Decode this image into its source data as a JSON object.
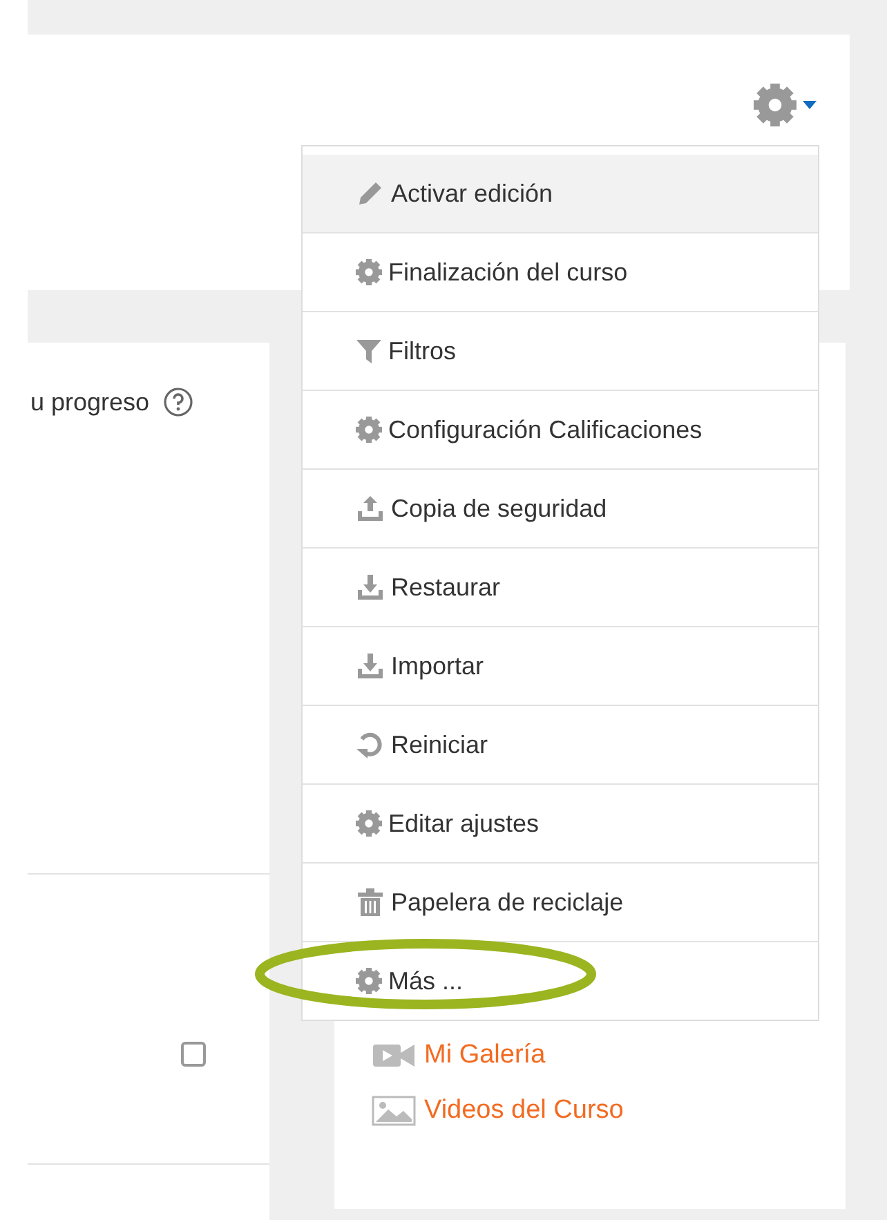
{
  "header": {
    "settings_button": {
      "expanded": true
    }
  },
  "menu": {
    "items": [
      {
        "label": "Activar edición",
        "kind": "pencil",
        "highlighted": true,
        "circled": false
      },
      {
        "label": "Finalización del curso",
        "kind": "gear",
        "highlighted": false,
        "circled": false
      },
      {
        "label": "Filtros",
        "kind": "filter",
        "highlighted": false,
        "circled": false
      },
      {
        "label": "Configuración Calificaciones",
        "kind": "gear",
        "highlighted": false,
        "circled": false
      },
      {
        "label": "Copia de seguridad",
        "kind": "upload",
        "highlighted": false,
        "circled": false
      },
      {
        "label": "Restaurar",
        "kind": "download",
        "highlighted": false,
        "circled": false
      },
      {
        "label": "Importar",
        "kind": "download",
        "highlighted": false,
        "circled": false
      },
      {
        "label": "Reiniciar",
        "kind": "refresh",
        "highlighted": false,
        "circled": false
      },
      {
        "label": "Editar ajustes",
        "kind": "gear",
        "highlighted": false,
        "circled": false
      },
      {
        "label": "Papelera de reciclaje",
        "kind": "trash",
        "highlighted": false,
        "circled": false
      },
      {
        "label": "Más ...",
        "kind": "gear",
        "highlighted": false,
        "circled": true
      }
    ]
  },
  "main": {
    "progress_label": "u progreso",
    "checkbox": {
      "checked": false
    }
  },
  "block": {
    "links": [
      {
        "label": "Mi Galería",
        "kind": "video"
      },
      {
        "label": "Videos del Curso",
        "kind": "image"
      }
    ]
  }
}
